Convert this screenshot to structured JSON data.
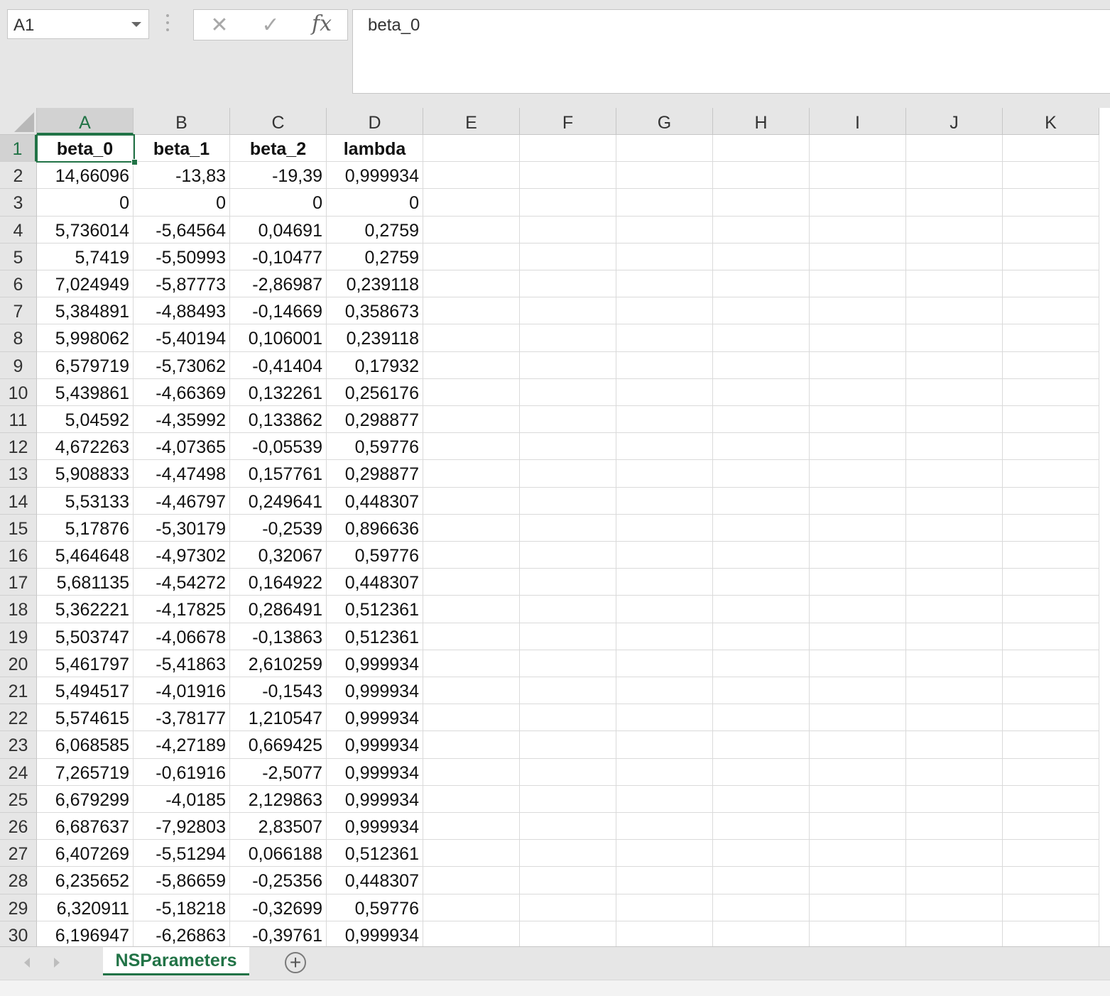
{
  "formula_bar": {
    "name_box": "A1",
    "cancel_icon": "✕",
    "enter_icon": "✓",
    "fx_label": "fx",
    "formula": "beta_0"
  },
  "columns": [
    "A",
    "B",
    "C",
    "D",
    "E",
    "F",
    "G",
    "H",
    "I",
    "J",
    "K"
  ],
  "selected_cell": "A1",
  "rows": [
    [
      "beta_0",
      "beta_1",
      "beta_2",
      "lambda"
    ],
    [
      "14,66096",
      "-13,83",
      "-19,39",
      "0,999934"
    ],
    [
      "0",
      "0",
      "0",
      "0"
    ],
    [
      "5,736014",
      "-5,64564",
      "0,04691",
      "0,2759"
    ],
    [
      "5,7419",
      "-5,50993",
      "-0,10477",
      "0,2759"
    ],
    [
      "7,024949",
      "-5,87773",
      "-2,86987",
      "0,239118"
    ],
    [
      "5,384891",
      "-4,88493",
      "-0,14669",
      "0,358673"
    ],
    [
      "5,998062",
      "-5,40194",
      "0,106001",
      "0,239118"
    ],
    [
      "6,579719",
      "-5,73062",
      "-0,41404",
      "0,17932"
    ],
    [
      "5,439861",
      "-4,66369",
      "0,132261",
      "0,256176"
    ],
    [
      "5,04592",
      "-4,35992",
      "0,133862",
      "0,298877"
    ],
    [
      "4,672263",
      "-4,07365",
      "-0,05539",
      "0,59776"
    ],
    [
      "5,908833",
      "-4,47498",
      "0,157761",
      "0,298877"
    ],
    [
      "5,53133",
      "-4,46797",
      "0,249641",
      "0,448307"
    ],
    [
      "5,17876",
      "-5,30179",
      "-0,2539",
      "0,896636"
    ],
    [
      "5,464648",
      "-4,97302",
      "0,32067",
      "0,59776"
    ],
    [
      "5,681135",
      "-4,54272",
      "0,164922",
      "0,448307"
    ],
    [
      "5,362221",
      "-4,17825",
      "0,286491",
      "0,512361"
    ],
    [
      "5,503747",
      "-4,06678",
      "-0,13863",
      "0,512361"
    ],
    [
      "5,461797",
      "-5,41863",
      "2,610259",
      "0,999934"
    ],
    [
      "5,494517",
      "-4,01916",
      "-0,1543",
      "0,999934"
    ],
    [
      "5,574615",
      "-3,78177",
      "1,210547",
      "0,999934"
    ],
    [
      "6,068585",
      "-4,27189",
      "0,669425",
      "0,999934"
    ],
    [
      "7,265719",
      "-0,61916",
      "-2,5077",
      "0,999934"
    ],
    [
      "6,679299",
      "-4,0185",
      "2,129863",
      "0,999934"
    ],
    [
      "6,687637",
      "-7,92803",
      "2,83507",
      "0,999934"
    ],
    [
      "6,407269",
      "-5,51294",
      "0,066188",
      "0,512361"
    ],
    [
      "6,235652",
      "-5,86659",
      "-0,25356",
      "0,448307"
    ],
    [
      "6,320911",
      "-5,18218",
      "-0,32699",
      "0,59776"
    ],
    [
      "6,196947",
      "-6,26863",
      "-0,39761",
      "0,999934"
    ]
  ],
  "sheet_tabs": [
    "NSParameters"
  ],
  "add_sheet_icon": "+",
  "accent_color": "#217346"
}
